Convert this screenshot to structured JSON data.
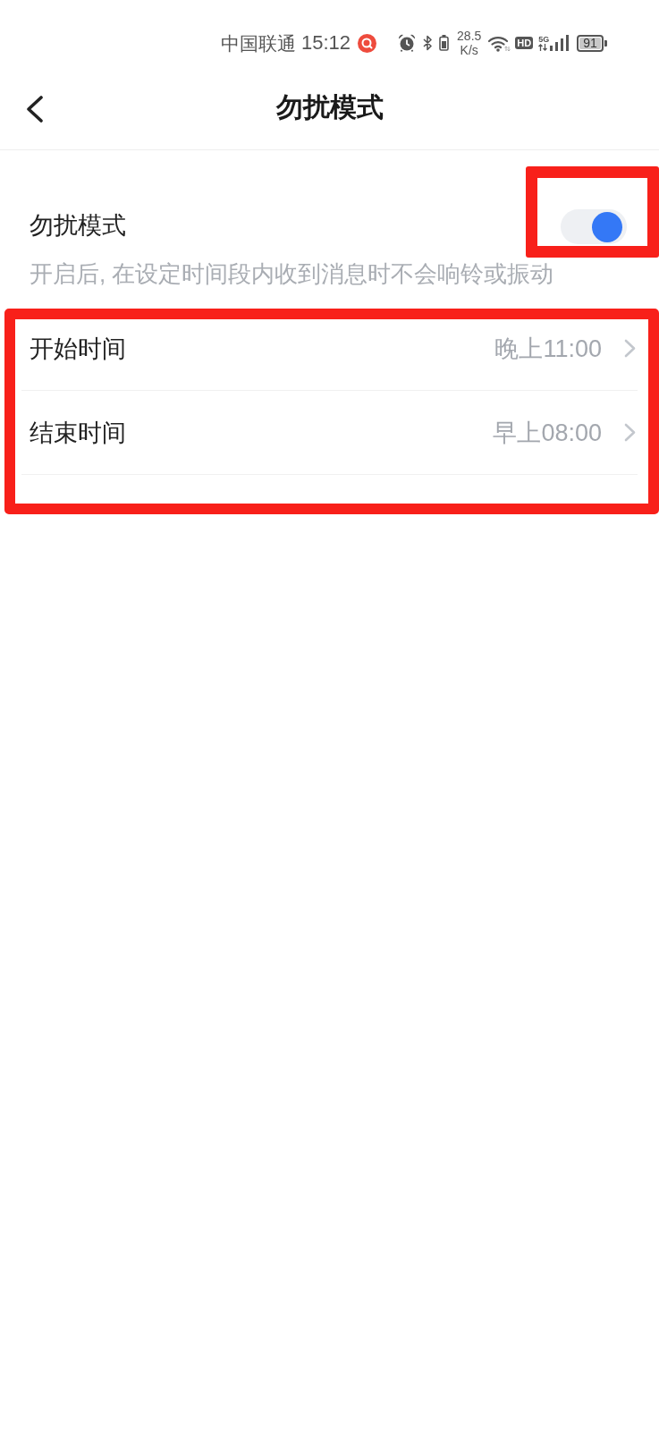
{
  "status_bar": {
    "carrier": "中国联通",
    "time": "15:12",
    "speed_value": "28.5",
    "speed_unit": "K/s",
    "hd_label": "HD",
    "network_label": "5G",
    "battery": "91"
  },
  "header": {
    "title": "勿扰模式"
  },
  "dnd": {
    "label": "勿扰模式",
    "description": "开启后, 在设定时间段内收到消息时不会响铃或振动",
    "on": true,
    "highlighted": true
  },
  "schedule": {
    "highlighted": true,
    "rows": [
      {
        "label": "开始时间",
        "value": "晚上11:00"
      },
      {
        "label": "结束时间",
        "value": "早上08:00"
      }
    ]
  }
}
